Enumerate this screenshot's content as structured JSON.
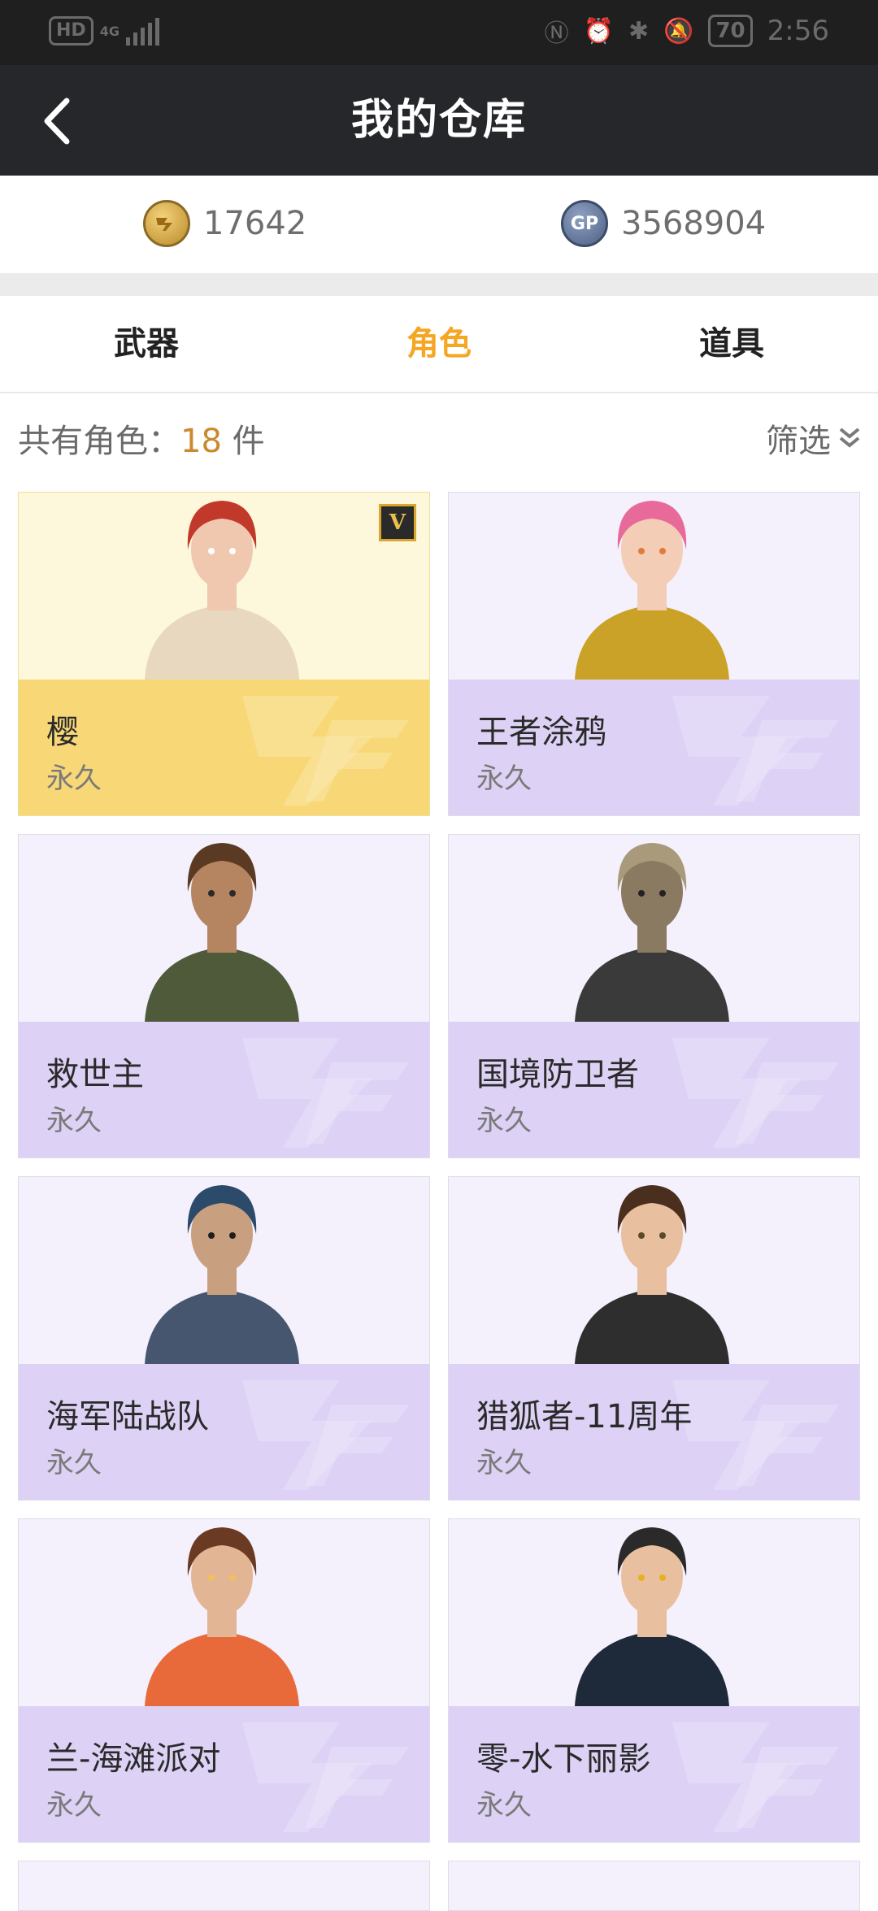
{
  "status_bar": {
    "left_badge": "HD",
    "network": "4G",
    "battery": "70",
    "time": "2:56"
  },
  "header": {
    "title": "我的仓库",
    "back_icon": "chevron-left-icon"
  },
  "currency": {
    "cf_points": "17642",
    "cf_icon": "cf-coin-icon",
    "gp": "3568904",
    "gp_icon": "gp-coin-icon",
    "gp_badge": "GP"
  },
  "tabs": [
    {
      "label": "武器",
      "active": false
    },
    {
      "label": "角色",
      "active": true
    },
    {
      "label": "道具",
      "active": false
    }
  ],
  "summary": {
    "prefix": "共有角色：",
    "count": "18",
    "unit": " 件",
    "filter_label": "筛选"
  },
  "colors": {
    "accent": "#f5a623",
    "header_bg": "#26272b",
    "card_purple": "#ddd2f5",
    "card_gold": "#f8d876"
  },
  "cards": [
    {
      "name": "樱",
      "duration": "永久",
      "rarity": "gold",
      "vip": "V"
    },
    {
      "name": "王者涂鸦",
      "duration": "永久",
      "rarity": "purple"
    },
    {
      "name": "救世主",
      "duration": "永久",
      "rarity": "purple"
    },
    {
      "name": "国境防卫者",
      "duration": "永久",
      "rarity": "purple"
    },
    {
      "name": "海军陆战队",
      "duration": "永久",
      "rarity": "purple"
    },
    {
      "name": "猎狐者-11周年",
      "duration": "永久",
      "rarity": "purple"
    },
    {
      "name": "兰-海滩派对",
      "duration": "永久",
      "rarity": "purple"
    },
    {
      "name": "零-水下丽影",
      "duration": "永久",
      "rarity": "purple"
    }
  ]
}
